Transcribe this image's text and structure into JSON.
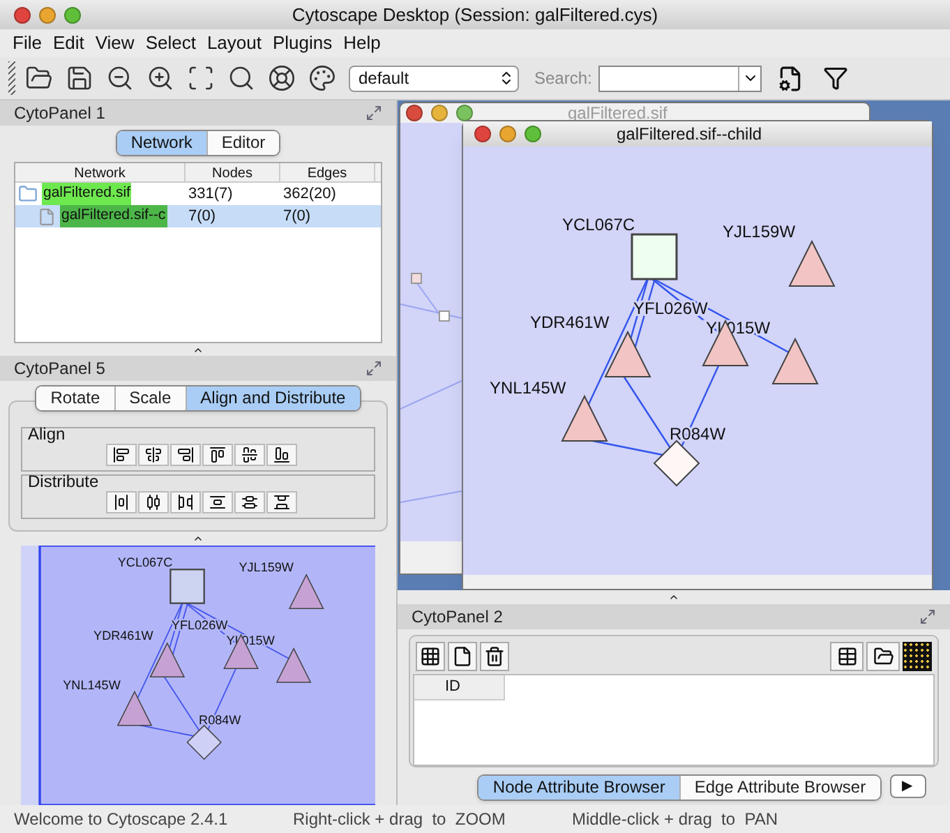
{
  "window": {
    "title": "Cytoscape Desktop (Session: galFiltered.cys)"
  },
  "menu": [
    "File",
    "Edit",
    "View",
    "Select",
    "Layout",
    "Plugins",
    "Help"
  ],
  "toolbar": {
    "style_select": "default",
    "search_label": "Search:"
  },
  "cytopanel_1": {
    "title": "CytoPanel 1",
    "tabs": [
      {
        "label": "Network",
        "selected": true
      },
      {
        "label": "Editor",
        "selected": false
      }
    ],
    "table": {
      "columns": [
        "Network",
        "Nodes",
        "Edges"
      ],
      "rows": [
        {
          "network": "galFiltered.sif",
          "nodes": "331(7)",
          "edges": "362(20)",
          "selected": false,
          "children": [
            {
              "network": "galFiltered.sif--c",
              "nodes": "7(0)",
              "edges": "7(0)",
              "selected": true
            }
          ]
        }
      ]
    }
  },
  "cytopanel_5": {
    "title": "CytoPanel 5",
    "tabs": [
      {
        "label": "Rotate",
        "selected": false
      },
      {
        "label": "Scale",
        "selected": false
      },
      {
        "label": "Align and Distribute",
        "selected": true
      }
    ],
    "groups": [
      {
        "title": "Align",
        "kind": "align"
      },
      {
        "title": "Distribute",
        "kind": "distribute"
      }
    ]
  },
  "overview": {
    "nodes": [
      {
        "label": "YCL067C",
        "kind": "square"
      },
      {
        "label": "YJL159W",
        "kind": "triangle"
      },
      {
        "label": "YFL026W",
        "kind": "triangle"
      },
      {
        "label": "YI 015W",
        "kind": "triangle"
      },
      {
        "label": "YDR461W",
        "kind": "triangle"
      },
      {
        "label": "YNL145W",
        "kind": "triangle"
      },
      {
        "label": "R084W",
        "kind": "diamond"
      }
    ]
  },
  "network_windows": [
    {
      "title": "galFiltered.sif"
    },
    {
      "title": "galFiltered.sif--child",
      "nodes": [
        {
          "label": "YCL067C",
          "kind": "square"
        },
        {
          "label": "YJL159W",
          "kind": "triangle"
        },
        {
          "label": "YFL026W",
          "kind": "triangle"
        },
        {
          "label": "YI 015W",
          "kind": "triangle"
        },
        {
          "label": "YDR461W",
          "kind": "triangle"
        },
        {
          "label": "YNL145W",
          "kind": "triangle"
        },
        {
          "label": "R084W",
          "kind": "diamond"
        }
      ]
    }
  ],
  "cytopanel_2": {
    "title": "CytoPanel 2",
    "table": {
      "columns": [
        "ID"
      ]
    },
    "tabs": [
      {
        "label": "Node Attribute Browser",
        "selected": true
      },
      {
        "label": "Edge Attribute Browser",
        "selected": false
      }
    ],
    "next_button": "▶"
  },
  "status_bar": [
    "Welcome to Cytoscape 2.4.1",
    "Right-click + drag  to  ZOOM",
    "Middle-click + drag  to  PAN"
  ]
}
